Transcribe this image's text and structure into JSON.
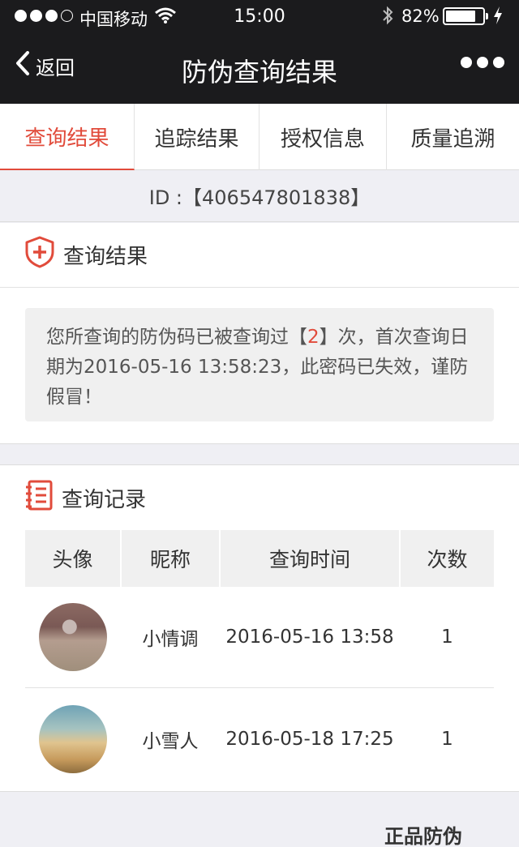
{
  "status_bar": {
    "carrier": "中国移动",
    "time": "15:00",
    "battery_percent": "82%",
    "battery_level": 0.82
  },
  "nav": {
    "back_label": "返回",
    "title": "防伪查询结果"
  },
  "tabs": [
    {
      "label": "查询结果",
      "active": true
    },
    {
      "label": "追踪结果",
      "active": false
    },
    {
      "label": "授权信息",
      "active": false
    },
    {
      "label": "质量追溯",
      "active": false
    }
  ],
  "id_bar": {
    "text": "ID :【406547801838】"
  },
  "result": {
    "heading": "查询结果",
    "notice_before": "您所查询的防伪码已被查询过【",
    "notice_count": "2",
    "notice_after": "】次，首次查询日期为2016-05-16 13:58:23，此密码已失效，谨防假冒！"
  },
  "records": {
    "heading": "查询记录",
    "columns": [
      "头像",
      "昵称",
      "查询时间",
      "次数"
    ],
    "rows": [
      {
        "nickname": "小情调",
        "time": "2016-05-16 13:58",
        "count": "1"
      },
      {
        "nickname": "小雪人",
        "time": "2016-05-18 17:25",
        "count": "1"
      }
    ]
  },
  "footer": {
    "label": "正品防伪"
  },
  "colors": {
    "accent": "#e14b3b",
    "bar_dark": "#1b1b1d",
    "background": "#efeff4"
  }
}
